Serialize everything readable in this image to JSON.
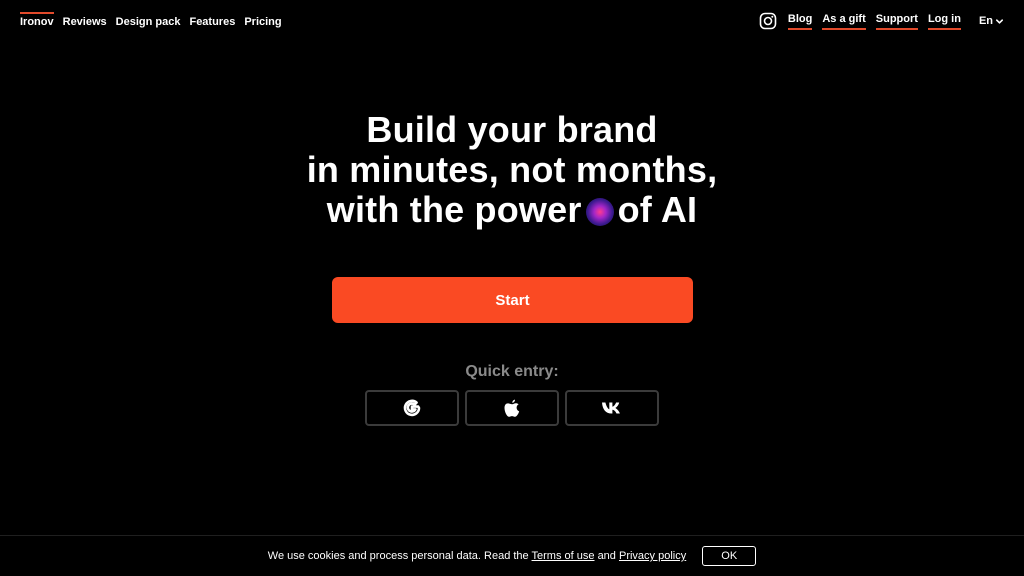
{
  "nav": {
    "left": [
      {
        "label": "Ironov"
      },
      {
        "label": "Reviews"
      },
      {
        "label": "Design pack"
      },
      {
        "label": "Features"
      },
      {
        "label": "Pricing"
      }
    ],
    "right": [
      {
        "label": "Blog"
      },
      {
        "label": "As a gift"
      },
      {
        "label": "Support"
      },
      {
        "label": "Log in"
      }
    ],
    "language": "En",
    "instagram_icon": "instagram-icon"
  },
  "hero": {
    "line1": "Build your brand",
    "line2": "in minutes, not months,",
    "line3_before": "with the power",
    "line3_after": "of AI",
    "orb_icon": "ai-orb-icon"
  },
  "cta": {
    "start_label": "Start"
  },
  "quick_entry": {
    "label": "Quick entry:",
    "providers": [
      "google-icon",
      "apple-icon",
      "vk-icon"
    ]
  },
  "cookie": {
    "text_before": "We use cookies and process personal data. Read the",
    "terms_link": "Terms of use",
    "and": "and",
    "privacy_link": "Privacy policy",
    "ok_label": "OK"
  },
  "colors": {
    "accent": "#fa4a23",
    "underline": "#e24a2b",
    "background": "#000000",
    "muted": "#8a8a8a"
  }
}
